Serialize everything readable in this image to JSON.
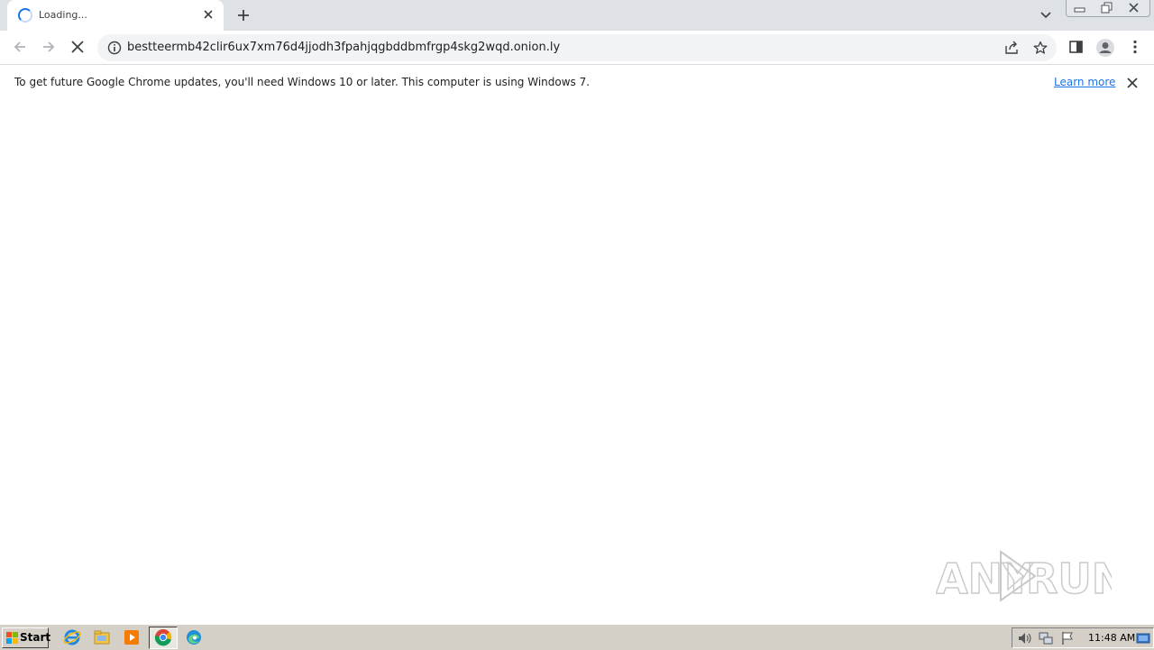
{
  "browser": {
    "tab": {
      "title": "Loading...",
      "icon": "loading-spinner"
    },
    "new_tab_icon": "plus-icon",
    "address_bar": {
      "url": "bestteermb42clir6ux7xm76d4jjodh3fpahjqgbddbmfrgp4skg2wqd.onion.ly",
      "security_icon": "info-icon"
    },
    "toolbar_icons": [
      "back-arrow-icon",
      "forward-arrow-icon",
      "stop-icon",
      "share-icon",
      "bookmark-star-icon",
      "side-panel-icon",
      "profile-icon",
      "kebab-menu-icon"
    ]
  },
  "infobar": {
    "message": "To get future Google Chrome updates, you'll need Windows 10 or later. This computer is using Windows 7.",
    "link": "Learn more"
  },
  "watermark": {
    "text_left": "ANY",
    "text_right": "RUN"
  },
  "taskbar": {
    "start_label": "Start",
    "apps": [
      "internet-explorer-icon",
      "file-explorer-icon",
      "media-player-icon",
      "chrome-icon",
      "edge-icon"
    ],
    "tray_icons": [
      "volume-icon",
      "network-icon",
      "action-center-flag-icon"
    ],
    "clock": "11:48 AM"
  },
  "colors": {
    "accent": "#1a73e8",
    "tabstrip": "#dee1e6",
    "taskbar": "#d4d0c8"
  }
}
